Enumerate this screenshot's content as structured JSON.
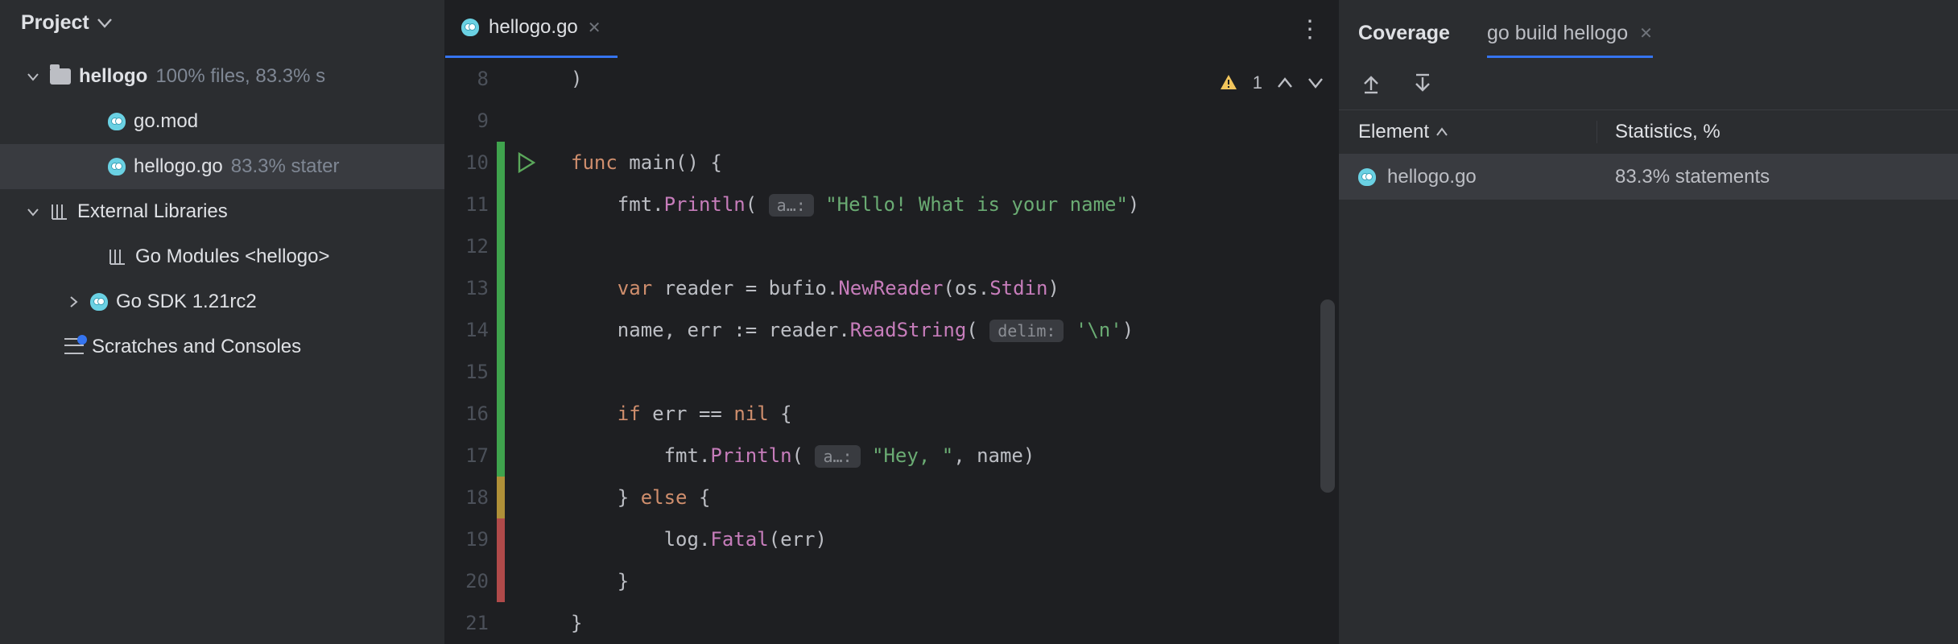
{
  "project": {
    "title": "Project",
    "tree": {
      "root": {
        "label": "hellogo",
        "stats": "100% files, 83.3% s"
      },
      "go_mod": "go.mod",
      "hellogo_file": {
        "label": "hellogo.go",
        "stats": "83.3% stater"
      },
      "external": "External Libraries",
      "go_modules": "Go Modules <hellogo>",
      "go_sdk": "Go SDK 1.21rc2",
      "scratches": "Scratches and Consoles"
    }
  },
  "editor": {
    "tab": {
      "label": "hellogo.go"
    },
    "warning_count": "1",
    "lines": [
      {
        "n": "8",
        "cov": "",
        "run": false,
        "tokens": [
          {
            "t": ")",
            "c": "ident"
          }
        ]
      },
      {
        "n": "9",
        "cov": "",
        "run": false,
        "tokens": []
      },
      {
        "n": "10",
        "cov": "green",
        "run": true,
        "tokens": [
          {
            "t": "func ",
            "c": "kw"
          },
          {
            "t": "main",
            "c": "ident"
          },
          {
            "t": "() {",
            "c": "ident"
          }
        ]
      },
      {
        "n": "11",
        "cov": "green",
        "run": false,
        "tokens": [
          {
            "t": "    fmt.",
            "c": "ident"
          },
          {
            "t": "Println",
            "c": "field"
          },
          {
            "t": "( ",
            "c": "ident"
          },
          {
            "t": "a…:",
            "c": "hint"
          },
          {
            "t": " ",
            "c": "ident"
          },
          {
            "t": "\"Hello! What is your name\"",
            "c": "str"
          },
          {
            "t": ")",
            "c": "ident"
          }
        ]
      },
      {
        "n": "12",
        "cov": "green",
        "run": false,
        "tokens": []
      },
      {
        "n": "13",
        "cov": "green",
        "run": false,
        "tokens": [
          {
            "t": "    ",
            "c": "ident"
          },
          {
            "t": "var ",
            "c": "kw"
          },
          {
            "t": "reader = bufio.",
            "c": "ident"
          },
          {
            "t": "NewReader",
            "c": "field"
          },
          {
            "t": "(os.",
            "c": "ident"
          },
          {
            "t": "Stdin",
            "c": "field"
          },
          {
            "t": ")",
            "c": "ident"
          }
        ]
      },
      {
        "n": "14",
        "cov": "green",
        "run": false,
        "tokens": [
          {
            "t": "    name, err := reader.",
            "c": "ident"
          },
          {
            "t": "ReadString",
            "c": "field"
          },
          {
            "t": "( ",
            "c": "ident"
          },
          {
            "t": "delim:",
            "c": "hint"
          },
          {
            "t": " ",
            "c": "ident"
          },
          {
            "t": "'\\n'",
            "c": "str"
          },
          {
            "t": ")",
            "c": "ident"
          }
        ]
      },
      {
        "n": "15",
        "cov": "green",
        "run": false,
        "tokens": []
      },
      {
        "n": "16",
        "cov": "green",
        "run": false,
        "tokens": [
          {
            "t": "    ",
            "c": "ident"
          },
          {
            "t": "if ",
            "c": "kw"
          },
          {
            "t": "err == ",
            "c": "ident"
          },
          {
            "t": "nil ",
            "c": "kw"
          },
          {
            "t": "{",
            "c": "ident"
          }
        ]
      },
      {
        "n": "17",
        "cov": "green",
        "run": false,
        "tokens": [
          {
            "t": "        fmt.",
            "c": "ident"
          },
          {
            "t": "Println",
            "c": "field"
          },
          {
            "t": "( ",
            "c": "ident"
          },
          {
            "t": "a…:",
            "c": "hint"
          },
          {
            "t": " ",
            "c": "ident"
          },
          {
            "t": "\"Hey, \"",
            "c": "str"
          },
          {
            "t": ", name)",
            "c": "ident"
          }
        ]
      },
      {
        "n": "18",
        "cov": "yellow",
        "run": false,
        "tokens": [
          {
            "t": "    } ",
            "c": "ident"
          },
          {
            "t": "else ",
            "c": "kw"
          },
          {
            "t": "{",
            "c": "ident"
          }
        ]
      },
      {
        "n": "19",
        "cov": "red",
        "run": false,
        "tokens": [
          {
            "t": "        log.",
            "c": "ident"
          },
          {
            "t": "Fatal",
            "c": "field"
          },
          {
            "t": "(err)",
            "c": "ident"
          }
        ]
      },
      {
        "n": "20",
        "cov": "red",
        "run": false,
        "tokens": [
          {
            "t": "    }",
            "c": "ident"
          }
        ]
      },
      {
        "n": "21",
        "cov": "",
        "run": false,
        "tokens": [
          {
            "t": "}",
            "c": "ident"
          }
        ]
      }
    ]
  },
  "coverage": {
    "tab_coverage": "Coverage",
    "tab_build": "go build hellogo",
    "head_element": "Element",
    "head_stats": "Statistics, %",
    "rows": [
      {
        "name": "hellogo.go",
        "stats": "83.3% statements"
      }
    ]
  }
}
